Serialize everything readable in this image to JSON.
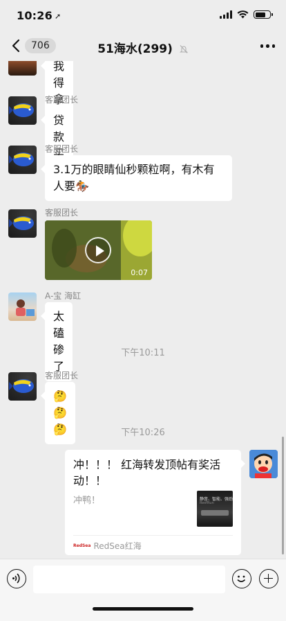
{
  "status_bar": {
    "time": "10:26",
    "location_glyph": "➚"
  },
  "nav": {
    "back_count": "706",
    "title": "51海水(299)",
    "mute": "muted-bell"
  },
  "messages": [
    {
      "sender": "",
      "text": "我得拿房子买鱼😳"
    },
    {
      "sender": "客服团长",
      "text": "贷款买😁"
    },
    {
      "sender": "客服团长",
      "text": "3.1万的眼睛仙秒颗粒啊，有木有人要🏇"
    },
    {
      "sender": "客服团长",
      "type": "video",
      "duration": "0:07"
    },
    {
      "sender": "A-宝 海缸",
      "text": "太磕碜了"
    },
    {
      "sender": "客服团长",
      "text": "🤔🤔🤔"
    }
  ],
  "timestamps": [
    "下午10:11",
    "下午10:26"
  ],
  "my_card": {
    "title": "冲！！！ 红海转发顶帖有奖活动！！",
    "desc": "冲鸭！",
    "source_logo": "RedSea",
    "source": "RedSea红海",
    "thumb_text_1": "静音、智能、强劲",
    "thumb_text_2": "ReefRun"
  },
  "input": {
    "placeholder": ""
  },
  "colors": {
    "background": "#ededed",
    "bubble": "#ffffff"
  }
}
